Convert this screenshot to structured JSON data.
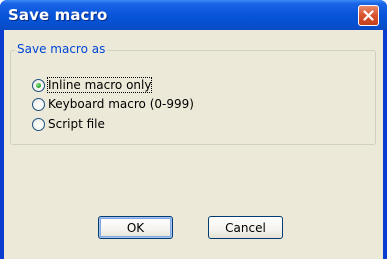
{
  "window": {
    "title": "Save macro",
    "close_icon": "close-icon"
  },
  "group": {
    "label": "Save macro as",
    "options": [
      {
        "label": "Inline macro only",
        "selected": true
      },
      {
        "label": "Keyboard macro (0-999)",
        "selected": false
      },
      {
        "label": "Script file",
        "selected": false
      }
    ]
  },
  "buttons": {
    "ok": "OK",
    "cancel": "Cancel"
  },
  "colors": {
    "titlebar": "#0a56dc",
    "dialog_bg": "#ece9d8",
    "group_label": "#0046d5",
    "close_button": "#d8532e"
  }
}
